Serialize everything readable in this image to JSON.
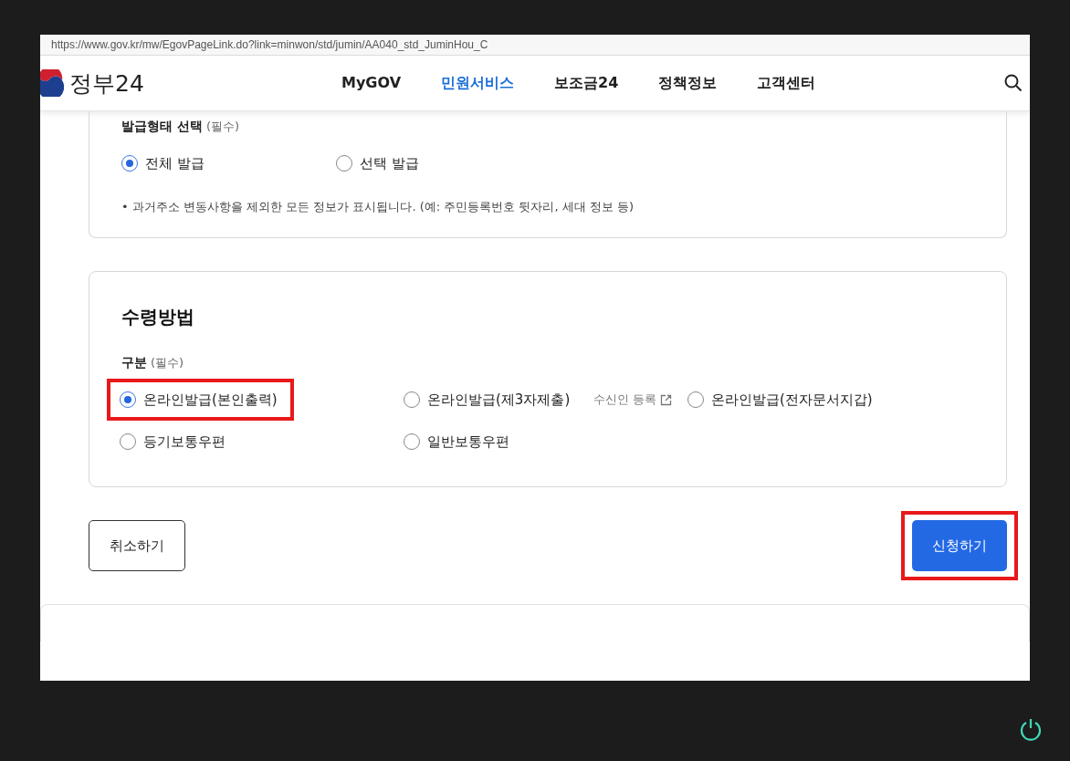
{
  "browser": {
    "url": "https://www.gov.kr/mw/EgovPageLink.do?link=minwon/std/jumin/AA040_std_JuminHou_C"
  },
  "header": {
    "logo": "정부24",
    "nav": [
      {
        "label": "MyGOV",
        "selected": false
      },
      {
        "label": "민원서비스",
        "selected": true
      },
      {
        "label": "보조금24",
        "selected": false
      },
      {
        "label": "정책정보",
        "selected": false
      },
      {
        "label": "고객센터",
        "selected": false
      }
    ]
  },
  "issue_type": {
    "label": "발급형태 선택",
    "required": "(필수)",
    "options": [
      {
        "label": "전체 발급",
        "selected": true
      },
      {
        "label": "선택 발급",
        "selected": false
      }
    ],
    "note": "• 과거주소 변동사항을 제외한 모든 정보가 표시됩니다. (예: 주민등록번호 뒷자리, 세대 정보 등)"
  },
  "receipt": {
    "title": "수령방법",
    "label": "구분",
    "required": "(필수)",
    "options": [
      {
        "label": "온라인발급(본인출력)",
        "selected": true,
        "highlighted": true
      },
      {
        "label": "온라인발급(제3자제출)",
        "selected": false,
        "highlighted": false,
        "link": "수신인 등록"
      },
      {
        "label": "온라인발급(전자문서지갑)",
        "selected": false,
        "highlighted": false
      },
      {
        "label": "등기보통우편",
        "selected": false,
        "highlighted": false
      },
      {
        "label": "일반보통우편",
        "selected": false,
        "highlighted": false
      }
    ]
  },
  "actions": [
    {
      "label": "취소하기",
      "kind": "secondary",
      "highlighted": false
    },
    {
      "label": "신청하기",
      "kind": "primary",
      "highlighted": true
    }
  ]
}
